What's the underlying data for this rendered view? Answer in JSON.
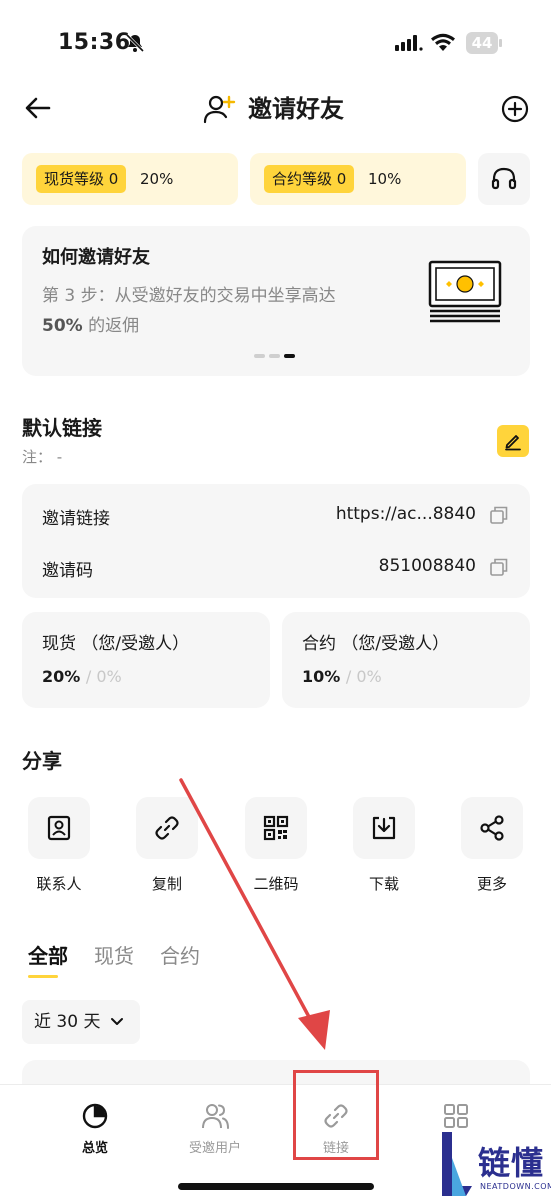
{
  "status_bar": {
    "time": "15:36",
    "battery": "44"
  },
  "header": {
    "title": "邀请好友"
  },
  "levels": {
    "spot_badge": "现货等级 0",
    "spot_value": "20%",
    "contract_badge": "合约等级 0",
    "contract_value": "10%"
  },
  "howto": {
    "title": "如何邀请好友",
    "desc_line1": "第 3 步：从受邀好友的交易中坐享高达",
    "desc_bold": "50%",
    "desc_tail": " 的返佣"
  },
  "default_link": {
    "title": "默认链接",
    "note": "注：  -",
    "invite_link_label": "邀请链接",
    "invite_link_value": "https://ac...8840",
    "invite_code_label": "邀请码",
    "invite_code_value": "851008840"
  },
  "ratios": {
    "spot_label": "现货 （您/受邀人）",
    "spot_you": "20%",
    "spot_invitee": "/ 0%",
    "contract_label": "合约 （您/受邀人）",
    "contract_you": "10%",
    "contract_invitee": "/ 0%"
  },
  "share": {
    "title": "分享",
    "items": [
      {
        "label": "联系人",
        "icon": "contact-icon"
      },
      {
        "label": "复制",
        "icon": "link-icon"
      },
      {
        "label": "二维码",
        "icon": "qr-code-icon"
      },
      {
        "label": "下载",
        "icon": "download-icon"
      },
      {
        "label": "更多",
        "icon": "share-icon"
      }
    ]
  },
  "tabs": [
    "全部",
    "现货",
    "合约"
  ],
  "period": "近 30 天",
  "bottom_nav": [
    {
      "label": "总览",
      "icon": "pie-chart-icon",
      "active": true
    },
    {
      "label": "受邀用户",
      "icon": "users-icon",
      "active": false
    },
    {
      "label": "链接",
      "icon": "link-icon",
      "active": false
    },
    {
      "label": "",
      "icon": "grid-icon",
      "active": false
    }
  ],
  "watermark": {
    "text": "链懂",
    "sub": "NEATDOWN.COM"
  },
  "colors": {
    "accent": "#ffd43b",
    "pill_bg": "#fff7db",
    "card_bg": "#f6f6f6",
    "annotation": "#e04646"
  }
}
